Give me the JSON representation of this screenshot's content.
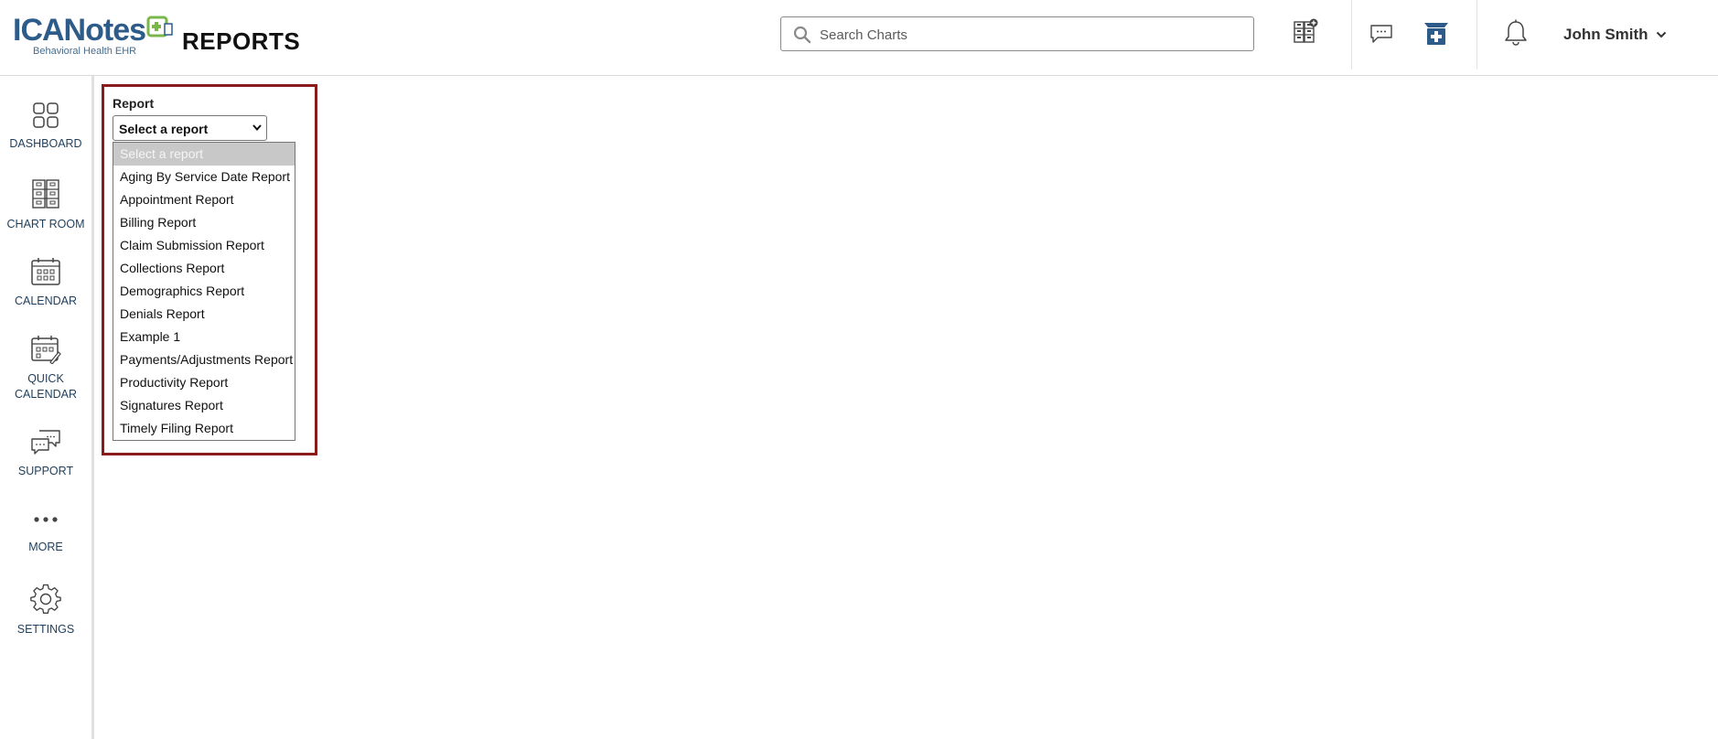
{
  "app": {
    "logo_main": "ICANotes",
    "logo_plus": "+",
    "logo_sub": "Behavioral Health EHR",
    "page_title": "REPORTS"
  },
  "header": {
    "search_placeholder": "Search Charts",
    "search_value": "",
    "user_name": "John Smith",
    "icons": [
      "new-chart-icon",
      "messages-icon",
      "prescription-icon",
      "notifications-bell-icon",
      "chevron-down-icon"
    ]
  },
  "sidebar": {
    "items": [
      {
        "label": "DASHBOARD",
        "icon": "dashboard-icon"
      },
      {
        "label": "CHART ROOM",
        "icon": "chart-room-icon"
      },
      {
        "label": "CALENDAR",
        "icon": "calendar-icon"
      },
      {
        "label": "QUICK CALENDAR",
        "icon": "quick-calendar-icon"
      },
      {
        "label": "SUPPORT",
        "icon": "support-icon"
      },
      {
        "label": "MORE",
        "icon": "more-dots-icon"
      },
      {
        "label": "SETTINGS",
        "icon": "gear-icon"
      }
    ]
  },
  "report": {
    "label": "Report",
    "selected": "Select a report",
    "options": [
      "Select a report",
      "Aging By Service Date Report",
      "Appointment Report",
      "Billing Report",
      "Claim Submission Report",
      "Collections Report",
      "Demographics Report",
      "Denials Report",
      "Example 1",
      "Payments/Adjustments Report",
      "Productivity Report",
      "Signatures Report",
      "Timely Filing Report"
    ]
  },
  "colors": {
    "brand_blue": "#2e5c8a",
    "brand_green": "#7ab648",
    "highlight_border": "#8b1a1a",
    "nav_text": "#1f3e5c",
    "selected_option_bg": "#c8c8c8"
  }
}
